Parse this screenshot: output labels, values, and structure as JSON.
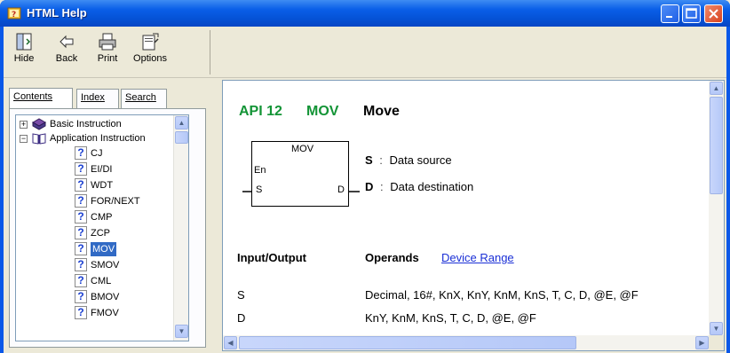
{
  "window": {
    "title": "HTML Help"
  },
  "toolbar": {
    "hide": "Hide",
    "back": "Back",
    "print": "Print",
    "options": "Options"
  },
  "nav": {
    "tabs": [
      "Contents",
      "Index",
      "Search"
    ],
    "active_tab": "Contents",
    "tree": [
      {
        "label": "Basic Instruction",
        "type": "book",
        "expander": "+"
      },
      {
        "label": "Application Instruction",
        "type": "book-open",
        "expander": "−"
      },
      {
        "label": "CJ",
        "type": "page"
      },
      {
        "label": "EI/DI",
        "type": "page"
      },
      {
        "label": "WDT",
        "type": "page"
      },
      {
        "label": "FOR/NEXT",
        "type": "page"
      },
      {
        "label": "CMP",
        "type": "page"
      },
      {
        "label": "ZCP",
        "type": "page"
      },
      {
        "label": "MOV",
        "type": "page",
        "selected": true
      },
      {
        "label": "SMOV",
        "type": "page"
      },
      {
        "label": "CML",
        "type": "page"
      },
      {
        "label": "BMOV",
        "type": "page"
      },
      {
        "label": "FMOV",
        "type": "page"
      }
    ]
  },
  "content": {
    "api": "API 12",
    "mnemonic": "MOV",
    "name": "Move",
    "diagram": {
      "title": "MOV",
      "en": "En",
      "s": "S",
      "d": "D"
    },
    "operands": [
      {
        "key": "S",
        "sep": ":",
        "desc": "Data source"
      },
      {
        "key": "D",
        "sep": ":",
        "desc": "Data destination"
      }
    ],
    "io_header": "Input/Output",
    "operands_header": "Operands",
    "device_range_link": "Device Range",
    "rows": [
      {
        "io": "S",
        "operands": "Decimal, 16#, KnX, KnY, KnM, KnS, T, C, D, @E, @F"
      },
      {
        "io": "D",
        "operands": "KnY, KnM, KnS, T, C, D, @E, @F"
      }
    ]
  },
  "colors": {
    "accent": "#139436",
    "titlebar": "#0a5fe8",
    "link": "#1a2fd6",
    "selection": "#316ac5"
  }
}
